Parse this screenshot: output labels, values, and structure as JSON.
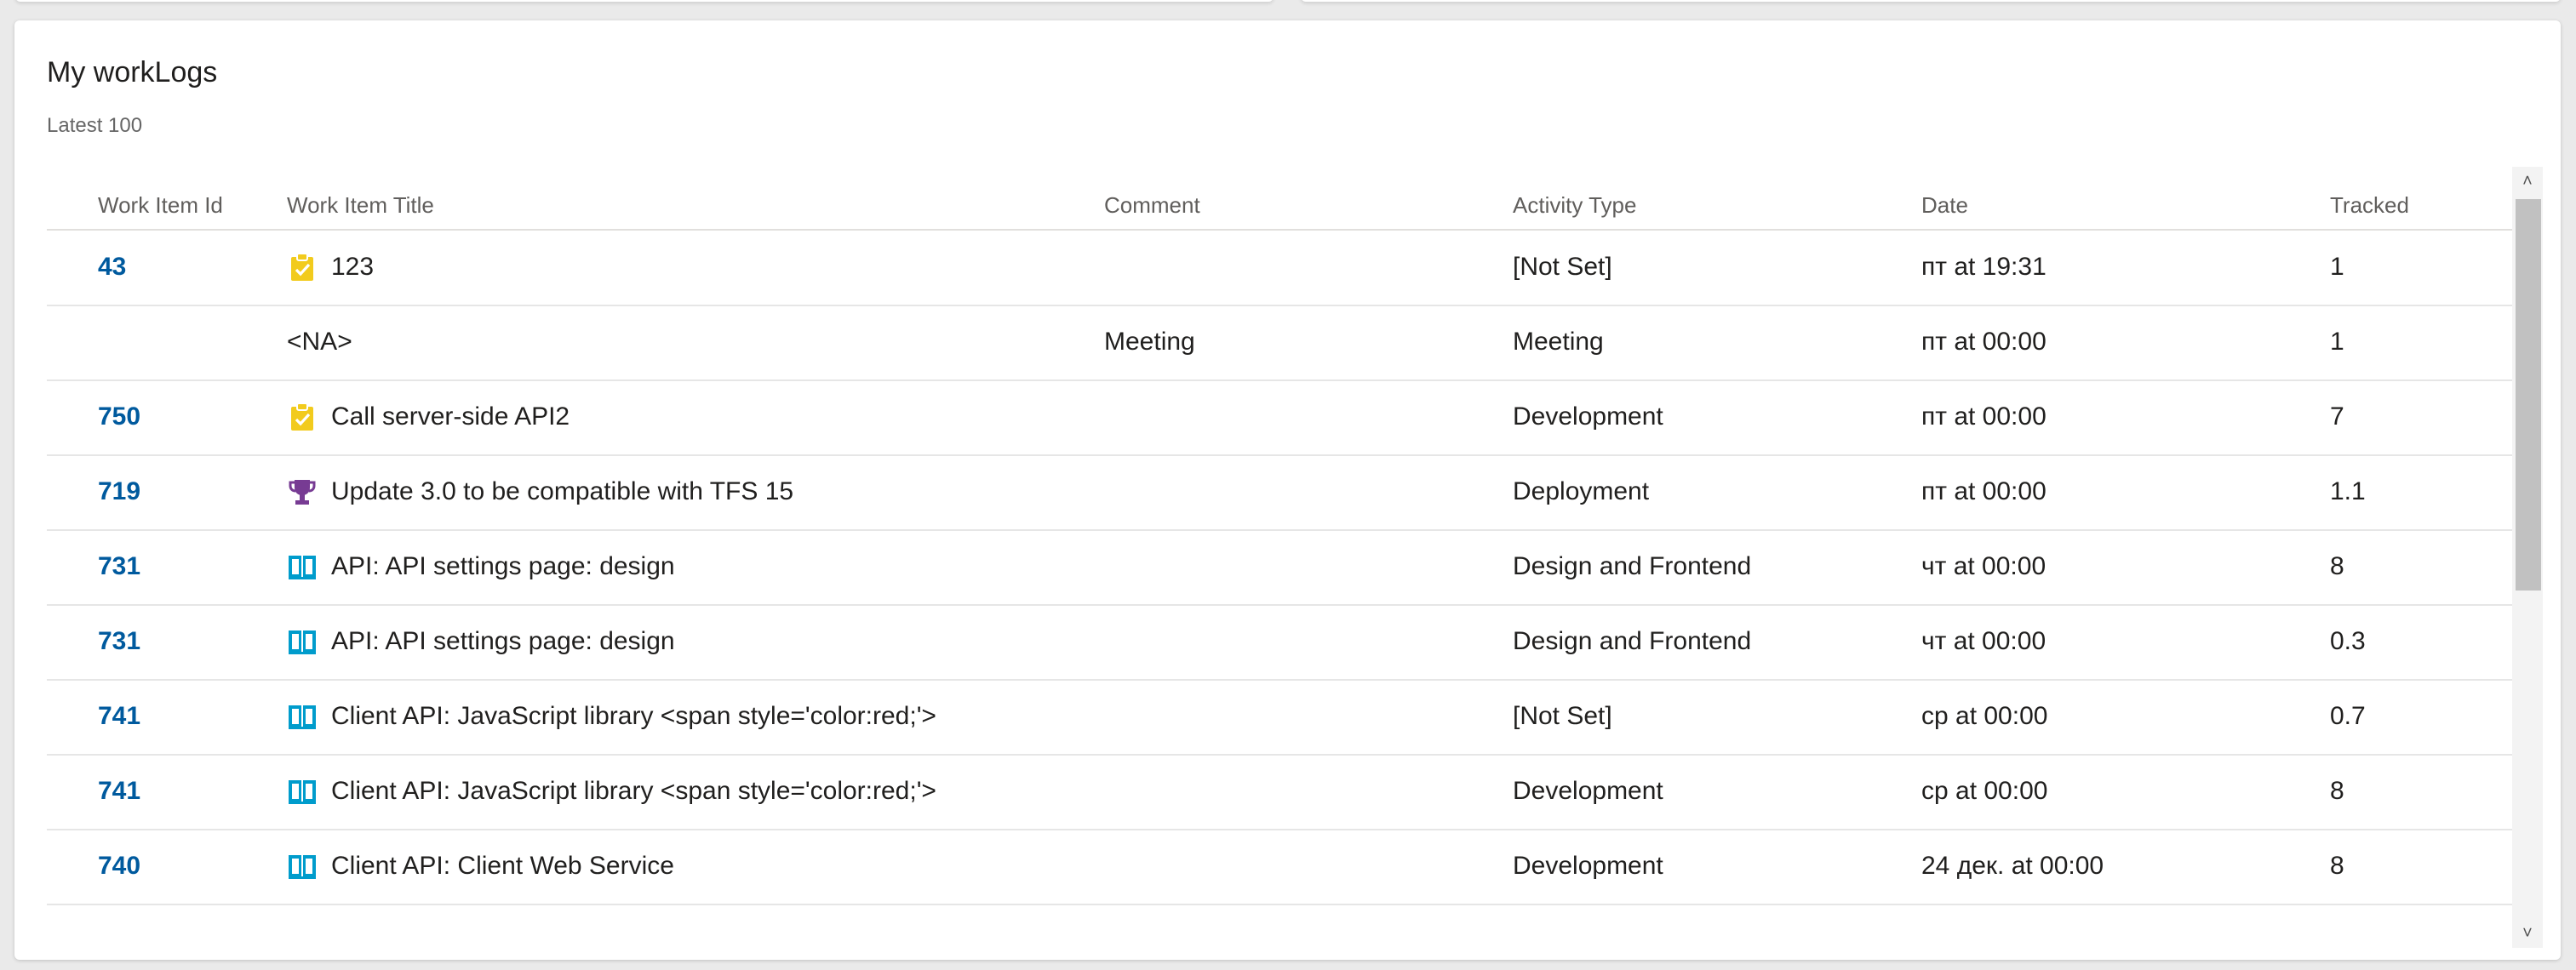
{
  "widget": {
    "title": "My workLogs",
    "subtitle": "Latest 100"
  },
  "table": {
    "headers": {
      "id": "Work Item Id",
      "title": "Work Item Title",
      "comment": "Comment",
      "activity": "Activity Type",
      "date": "Date",
      "tracked": "Tracked"
    },
    "rows": [
      {
        "id": "43",
        "icon": "task-icon",
        "title": "123",
        "comment": "",
        "activity": "[Not Set]",
        "date": "пт at 19:31",
        "tracked": "1"
      },
      {
        "id": "",
        "icon": "",
        "title": "<NA>",
        "comment": "Meeting",
        "activity": "Meeting",
        "date": "пт at 00:00",
        "tracked": "1"
      },
      {
        "id": "750",
        "icon": "task-icon",
        "title": "Call server-side API2",
        "comment": "",
        "activity": "Development",
        "date": "пт at 00:00",
        "tracked": "7"
      },
      {
        "id": "719",
        "icon": "trophy-icon",
        "title": "Update 3.0 to be compatible with TFS 15",
        "comment": "",
        "activity": "Deployment",
        "date": "пт at 00:00",
        "tracked": "1.1"
      },
      {
        "id": "731",
        "icon": "book-icon",
        "title": "API: API settings page: design",
        "comment": "",
        "activity": "Design and Frontend",
        "date": "чт at 00:00",
        "tracked": "8"
      },
      {
        "id": "731",
        "icon": "book-icon",
        "title": "API: API settings page: design",
        "comment": "",
        "activity": "Design and Frontend",
        "date": "чт at 00:00",
        "tracked": "0.3"
      },
      {
        "id": "741",
        "icon": "book-icon",
        "title": "Client API: JavaScript library <span style='color:red;'>",
        "comment": "",
        "activity": "[Not Set]",
        "date": "ср at 00:00",
        "tracked": "0.7"
      },
      {
        "id": "741",
        "icon": "book-icon",
        "title": "Client API: JavaScript library <span style='color:red;'>",
        "comment": "",
        "activity": "Development",
        "date": "ср at 00:00",
        "tracked": "8"
      },
      {
        "id": "740",
        "icon": "book-icon",
        "title": "Client API: Client Web Service",
        "comment": "",
        "activity": "Development",
        "date": "24 дек. at 00:00",
        "tracked": "8"
      }
    ]
  },
  "colors": {
    "id_link": "#005a9e",
    "task_icon": "#f2cb1d",
    "trophy_icon": "#773b93",
    "book_icon": "#009ccc"
  }
}
